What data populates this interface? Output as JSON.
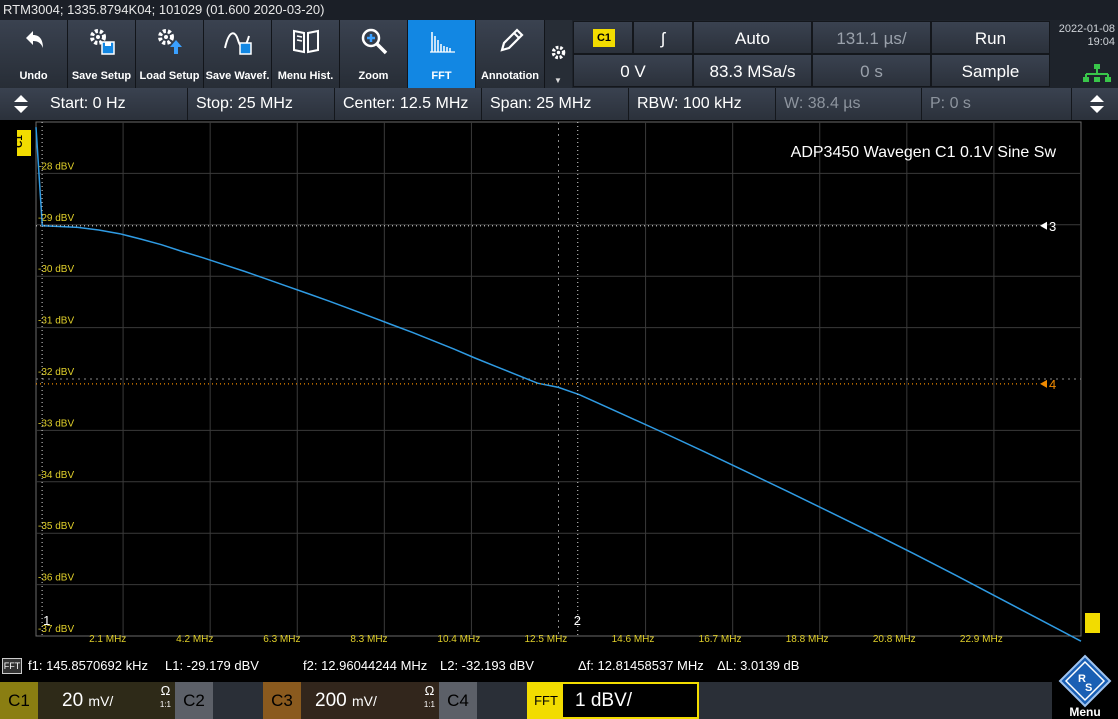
{
  "titlebar": {
    "text": "RTM3004; 1335.8794K04; 101029 (01.600 2020-03-20)"
  },
  "toolbar": {
    "undo": "Undo",
    "save_setup": "Save Setup",
    "load_setup": "Load Setup",
    "save_waveform": "Save Wavef.",
    "menu_hist": "Menu Hist.",
    "zoom": "Zoom",
    "fft": "FFT",
    "annotation": "Annotation"
  },
  "trigger": {
    "channel": "C1",
    "slope": "ʃ",
    "mode": "Auto",
    "horizontal_scale": "131.1 µs/",
    "run_state": "Run",
    "level": "0 V",
    "sample_rate": "83.3 MSa/s",
    "position": "0 s",
    "acq_mode": "Sample"
  },
  "clock": {
    "date": "2022-01-08",
    "time": "19:04"
  },
  "freqbar": {
    "start": "Start: 0 Hz",
    "stop": "Stop: 25 MHz",
    "center": "Center: 12.5 MHz",
    "span": "Span: 25 MHz",
    "rbw": "RBW: 100 kHz",
    "window": "W: 38.4 µs",
    "position": "P: 0 s"
  },
  "plot": {
    "annotation_text": "ADP3450 Wavegen C1 0.1V Sine Sw",
    "channel_marker": "C1",
    "y_labels": [
      "-28 dBV",
      "-29 dBV",
      "-30 dBV",
      "-31 dBV",
      "-32 dBV",
      "-33 dBV",
      "-34 dBV",
      "-35 dBV",
      "-36 dBV",
      "-37 dBV"
    ],
    "x_labels": [
      "2.1 MHz",
      "4.2 MHz",
      "6.3 MHz",
      "8.3 MHz",
      "10.4 MHz",
      "12.5 MHz",
      "14.6 MHz",
      "16.7 MHz",
      "18.8 MHz",
      "20.8 MHz",
      "22.9 MHz"
    ],
    "cursor1_label": "1",
    "cursor2_label": "2",
    "cursor3_label": "3",
    "cursor4_label": "4",
    "trace_color": "#2f9be3",
    "cursor_h_color": "#f08a00"
  },
  "measurements": {
    "badge": "FFT",
    "f1": "f1: 145.8570692 kHz",
    "l1": "L1: -29.179 dBV",
    "f2": "f2: 12.96044244 MHz",
    "l2": "L2: -32.193 dBV",
    "df": "Δf: 12.81458537 MHz",
    "dl": "ΔL: 3.0139 dB"
  },
  "channels": {
    "c1_label": "C1",
    "c1_scale": "20",
    "c1_unit": "mV/",
    "c1_ohm": "Ω",
    "c1_ratio": "1:1",
    "c2_label": "C2",
    "c3_label": "C3",
    "c3_scale": "200",
    "c3_unit": "mV/",
    "c3_ohm": "Ω",
    "c3_ratio": "1:1",
    "c4_label": "C4",
    "fft_label": "FFT",
    "fft_scale": "1 dBV/"
  },
  "menu": {
    "label": "Menu"
  },
  "chart_data": {
    "type": "line",
    "xlabel": "",
    "ylabel": "",
    "title": "ADP3450 Wavegen C1 0.1V Sine Sw",
    "xlim": [
      0,
      25
    ],
    "ylim": [
      -37,
      -27.2
    ],
    "x_tick_labels": [
      "2.1 MHz",
      "4.2 MHz",
      "6.3 MHz",
      "8.3 MHz",
      "10.4 MHz",
      "12.5 MHz",
      "14.6 MHz",
      "16.7 MHz",
      "18.8 MHz",
      "20.8 MHz",
      "22.9 MHz"
    ],
    "y_tick_labels": [
      "-28 dBV",
      "-29 dBV",
      "-30 dBV",
      "-31 dBV",
      "-32 dBV",
      "-33 dBV",
      "-34 dBV",
      "-35 dBV",
      "-36 dBV",
      "-37 dBV"
    ],
    "series": [
      {
        "x_mhz": [
          0,
          0.15,
          0.5,
          1.0,
          1.5,
          2.0,
          2.5,
          3.0,
          3.5,
          4.0,
          4.5,
          5.0,
          5.5,
          6.0,
          6.5,
          7.0,
          7.5,
          8.0,
          8.5,
          9.0,
          9.5,
          10.0,
          10.5,
          11.0,
          11.5,
          12.0,
          12.5,
          13.0,
          14.0,
          15.0,
          16.0,
          17.0,
          18.0,
          19.0,
          20.0,
          21.0,
          22.0,
          23.0,
          24.0,
          25.0
        ],
        "y_dbv": [
          -27.3,
          -29.18,
          -29.19,
          -29.21,
          -29.26,
          -29.33,
          -29.43,
          -29.54,
          -29.67,
          -29.79,
          -29.92,
          -30.05,
          -30.19,
          -30.33,
          -30.47,
          -30.61,
          -30.76,
          -30.91,
          -31.06,
          -31.21,
          -31.37,
          -31.53,
          -31.7,
          -31.86,
          -32.02,
          -32.18,
          -32.26,
          -32.4,
          -32.76,
          -33.12,
          -33.49,
          -33.87,
          -34.25,
          -34.64,
          -35.03,
          -35.43,
          -35.84,
          -36.26,
          -36.68,
          -37.1
        ]
      }
    ],
    "cursors": {
      "f1_mhz": 0.1458570692,
      "l1_dbv": -29.179,
      "f2_mhz": 12.96044244,
      "l2_dbv": -32.193
    },
    "grid": true
  }
}
